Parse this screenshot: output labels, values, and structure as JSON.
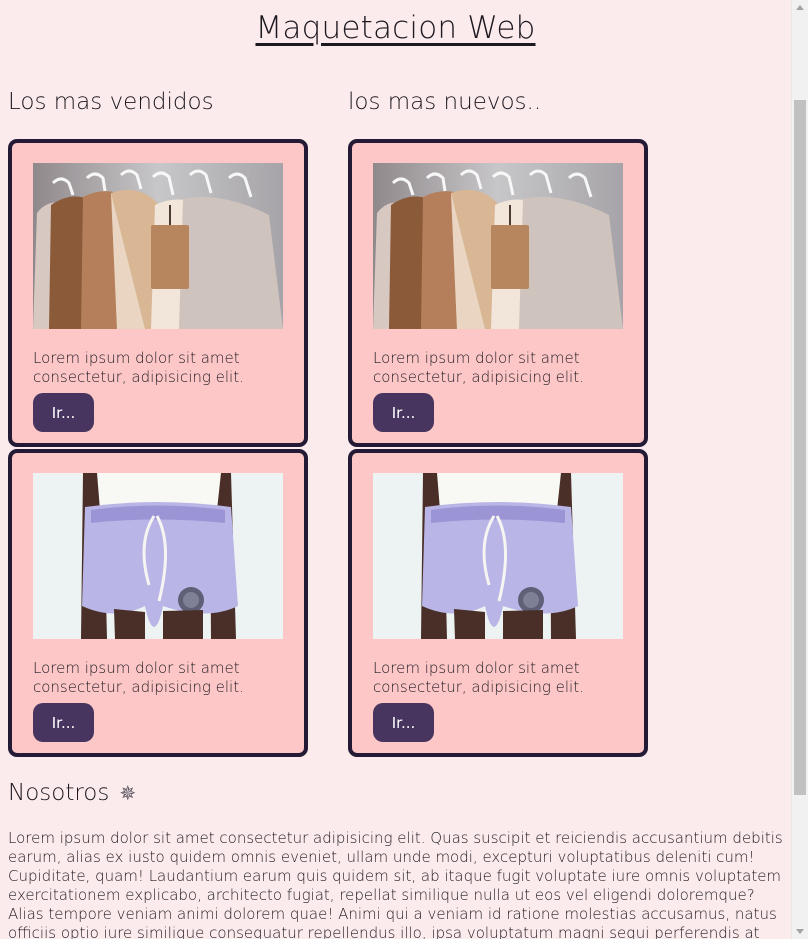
{
  "page": {
    "title": "Maquetacion Web"
  },
  "sections": {
    "best_sellers_title": "Los mas vendidos",
    "newest_title": "los mas nuevos.."
  },
  "cards": {
    "text": "Lorem ipsum dolor sit amet consectetur, adipisicing elit.",
    "button_label": "Ir...",
    "images": [
      {
        "name": "clothes-on-hangers-image",
        "description": "clothing rack with neutral jackets"
      },
      {
        "name": "lavender-shorts-image",
        "description": "lavender shorts with drawstring"
      }
    ]
  },
  "about": {
    "title": "Nosotros",
    "icon": "sparkle-icon",
    "text": "Lorem ipsum dolor sit amet consectetur adipisicing elit. Quas suscipit et reiciendis accusantium debitis earum, alias ex iusto quidem omnis eveniet, ullam unde modi, excepturi voluptatibus deleniti cum! Cupiditate, quam! Laudantium earum quis quidem sit, ab itaque fugit voluptate iure omnis voluptatem exercitationem explicabo, architecto fugiat, repellat similique nulla ut eos vel eligendi doloremque? Alias tempore veniam animi dolorem quae! Animi qui a veniam id ratione molestias accusamus, natus officiis optio iure similique consequatur repellendus illo, ipsa voluptatum magni sequi perferendis at pariatur doloremque fuga reiciendis ea. Repellat."
  },
  "colors": {
    "background": "#fcebec",
    "card_background": "#fdc7c7",
    "card_border": "#231a36",
    "button_background": "#47355f",
    "button_text": "#ffffff"
  }
}
